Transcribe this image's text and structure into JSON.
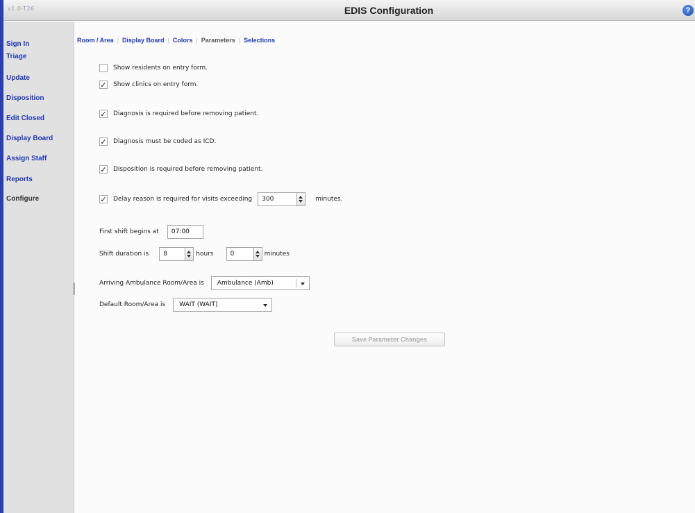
{
  "app": {
    "version": "v1.0-T26",
    "title": "EDIS Configuration",
    "help": "?"
  },
  "sidebar": {
    "items": [
      {
        "label": "Sign In"
      },
      {
        "label": "Triage"
      },
      {
        "label": "Update"
      },
      {
        "label": "Disposition"
      },
      {
        "label": "Edit Closed"
      },
      {
        "label": "Display Board"
      },
      {
        "label": "Assign Staff"
      },
      {
        "label": "Reports"
      },
      {
        "label": "Configure"
      }
    ]
  },
  "tabs": [
    {
      "label": "Room / Area"
    },
    {
      "label": "Display Board"
    },
    {
      "label": "Colors"
    },
    {
      "label": "Parameters",
      "active": true
    },
    {
      "label": "Selections"
    }
  ],
  "params": {
    "show_residents": {
      "label": "Show residents on entry form.",
      "checked": false
    },
    "show_clinics": {
      "label": "Show clinics on entry form.",
      "checked": true
    },
    "diag_required": {
      "label": "Diagnosis is required before removing patient.",
      "checked": true
    },
    "diag_icd": {
      "label": "Diagnosis must be coded as ICD.",
      "checked": true
    },
    "dispo_required": {
      "label": "Disposition is required before removing patient.",
      "checked": true
    },
    "delay_reason": {
      "label": "Delay reason is required for visits exceeding",
      "checked": true,
      "value": "300",
      "unit": "minutes."
    },
    "first_shift": {
      "label": "First shift begins at",
      "value": "07:00"
    },
    "shift_duration": {
      "label": "Shift duration is",
      "hours_value": "8",
      "hours_unit": "hours",
      "minutes_value": "0",
      "minutes_unit": "minutes"
    },
    "ambulance_area": {
      "label": "Arriving Ambulance Room/Area is",
      "value": "Ambulance (Amb)"
    },
    "default_area": {
      "label": "Default Room/Area is",
      "value": "WAIT (WAIT)"
    },
    "check_glyph": "✓"
  },
  "actions": {
    "save_label": "Save Parameter Changes"
  },
  "colors": {
    "accent": "#2238b0",
    "edge": "#2a3fb0"
  }
}
